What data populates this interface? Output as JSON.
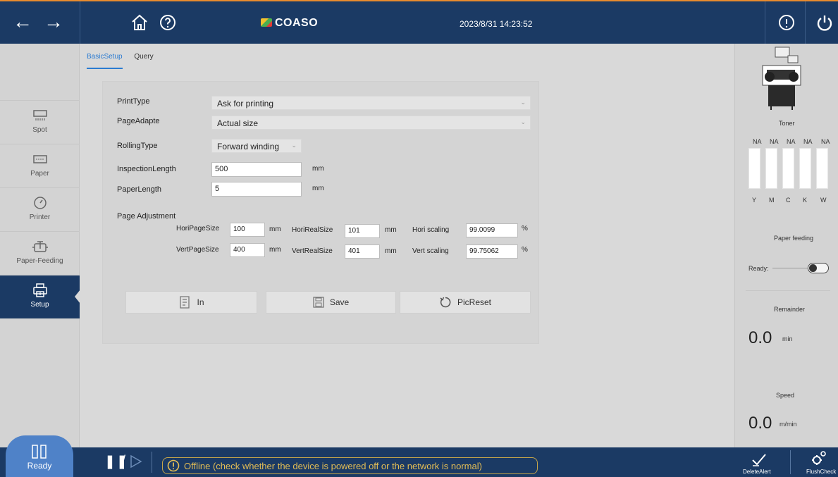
{
  "header": {
    "brand": "COASO",
    "datetime": "2023/8/31 14:23:52",
    "icons": [
      "back-icon",
      "forward-icon",
      "home-icon",
      "help-icon",
      "info-icon",
      "power-icon"
    ]
  },
  "sidebar": {
    "items": [
      {
        "label": "Spot",
        "icon": "spot-icon"
      },
      {
        "label": "Paper",
        "icon": "paper-icon"
      },
      {
        "label": "Printer",
        "icon": "printer-gauge-icon"
      },
      {
        "label": "Paper-Feeding",
        "icon": "paper-feeding-icon"
      },
      {
        "label": "Setup",
        "icon": "setup-icon",
        "active": true
      }
    ],
    "status": "Ready"
  },
  "tabs": [
    {
      "label": "BasicSetup",
      "active": true
    },
    {
      "label": "Query",
      "active": false
    }
  ],
  "form": {
    "print_type": {
      "label": "PrintType",
      "value": "Ask for printing"
    },
    "page_adapte": {
      "label": "PageAdapte",
      "value": "Actual size"
    },
    "rolling_type": {
      "label": "RollingType",
      "value": "Forward winding"
    },
    "inspection_length": {
      "label": "InspectionLength",
      "value": "500",
      "unit": "mm"
    },
    "paper_length": {
      "label": "PaperLength",
      "value": "5",
      "unit": "mm"
    },
    "page_adjustment": {
      "title": "Page Adjustment",
      "hori_page_size": {
        "label": "HoriPageSize",
        "value": "100",
        "unit": "mm"
      },
      "hori_real_size": {
        "label": "HoriRealSize",
        "value": "101",
        "unit": "mm"
      },
      "hori_scaling": {
        "label": "Hori scaling",
        "value": "99.0099",
        "unit": "%"
      },
      "vert_page_size": {
        "label": "VertPageSize",
        "value": "400",
        "unit": "mm"
      },
      "vert_real_size": {
        "label": "VertRealSize",
        "value": "401",
        "unit": "mm"
      },
      "vert_scaling": {
        "label": "Vert scaling",
        "value": "99.75062",
        "unit": "%"
      }
    }
  },
  "buttons": {
    "in": "In",
    "save": "Save",
    "pic_reset": "PicReset"
  },
  "right_panel": {
    "toner_title": "Toner",
    "toner_levels": [
      "NA",
      "NA",
      "NA",
      "NA",
      "NA"
    ],
    "toner_channels": [
      "Y",
      "M",
      "C",
      "K",
      "W"
    ],
    "paper_feeding_title": "Paper feeding",
    "ready_label": "Ready:",
    "remainder_title": "Remainder",
    "remainder_value": "0.0",
    "remainder_unit": "min",
    "speed_title": "Speed",
    "speed_value": "0.0",
    "speed_unit": "m/min"
  },
  "footer": {
    "alert": "Offline (check whether the device is powered off or the network is normal)",
    "delete_alert": "DeleteAlert",
    "flush_check": "FlushCheck"
  },
  "colors": {
    "navy": "#1b3a64",
    "accent": "#2b7bd1",
    "alert": "#e3bd55",
    "top_border": "#e88b2e"
  }
}
